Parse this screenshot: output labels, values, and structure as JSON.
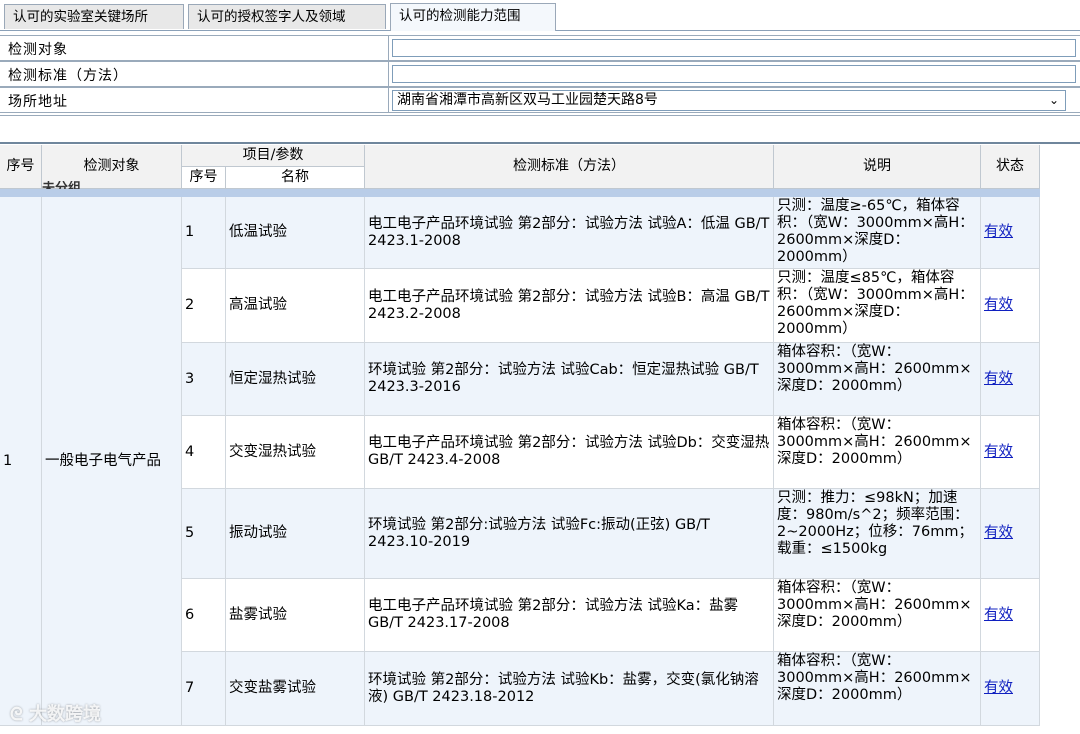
{
  "tabs": [
    {
      "label": "认可的实验室关键场所"
    },
    {
      "label": "认可的授权签字人及领域"
    },
    {
      "label": "认可的检测能力范围"
    }
  ],
  "filters": {
    "object_label": "检测对象",
    "standard_label": "检测标准（方法）",
    "address_label": "场所地址",
    "address_value": "湖南省湘潭市高新区双马工业园楚天路8号"
  },
  "table": {
    "headers": {
      "seq": "序号",
      "object": "检测对象",
      "item_param": "项目/参数",
      "sub_seq": "序号",
      "name": "名称",
      "standard": "检测标准（方法）",
      "note": "说明",
      "status": "状态"
    },
    "group_stub": "未分组",
    "group": {
      "seq": "1",
      "object": "一般电子电气产品"
    },
    "rows": [
      {
        "no": "1",
        "name": "低温试验",
        "standard": "电工电子产品环境试验 第2部分：试验方法 试验A：低温 GB/T 2423.1-2008",
        "note": "只测：温度≥-65℃，箱体容积：（宽W：3000mm×高H：2600mm×深度D：2000mm）",
        "status": "有效"
      },
      {
        "no": "2",
        "name": "高温试验",
        "standard": "电工电子产品环境试验 第2部分：试验方法 试验B：高温 GB/T 2423.2-2008",
        "note": "只测：温度≤85℃，箱体容积：（宽W：3000mm×高H：2600mm×深度D：2000mm）",
        "status": "有效"
      },
      {
        "no": "3",
        "name": "恒定湿热试验",
        "standard": "环境试验 第2部分：试验方法 试验Cab：恒定湿热试验 GB/T 2423.3-2016",
        "note": "箱体容积：（宽W：3000mm×高H：2600mm×深度D：2000mm）",
        "status": "有效"
      },
      {
        "no": "4",
        "name": "交变湿热试验",
        "standard": "电工电子产品环境试验 第2部分：试验方法 试验Db：交变湿热 GB/T 2423.4-2008",
        "note": "箱体容积：（宽W：3000mm×高H：2600mm×深度D：2000mm）",
        "status": "有效"
      },
      {
        "no": "5",
        "name": "振动试验",
        "standard": "环境试验 第2部分:试验方法 试验Fc:振动(正弦) GB/T 2423.10-2019",
        "note": "只测：推力：≤98kN；加速度：980m/s^2；频率范围：2~2000Hz；位移：76mm；载重：≤1500kg",
        "status": "有效"
      },
      {
        "no": "6",
        "name": "盐雾试验",
        "standard": "电工电子产品环境试验 第2部分：试验方法 试验Ka：盐雾 GB/T 2423.17-2008",
        "note": "箱体容积：（宽W：3000mm×高H：2600mm×深度D：2000mm）",
        "status": "有效"
      },
      {
        "no": "7",
        "name": "交变盐雾试验",
        "standard": "环境试验 第2部分：试验方法 试验Kb：盐雾，交变(氯化钠溶液) GB/T 2423.18-2012",
        "note": "箱体容积：（宽W：3000mm×高H：2600mm×深度D：2000mm）",
        "status": "有效"
      }
    ]
  },
  "watermark": "大数跨境"
}
